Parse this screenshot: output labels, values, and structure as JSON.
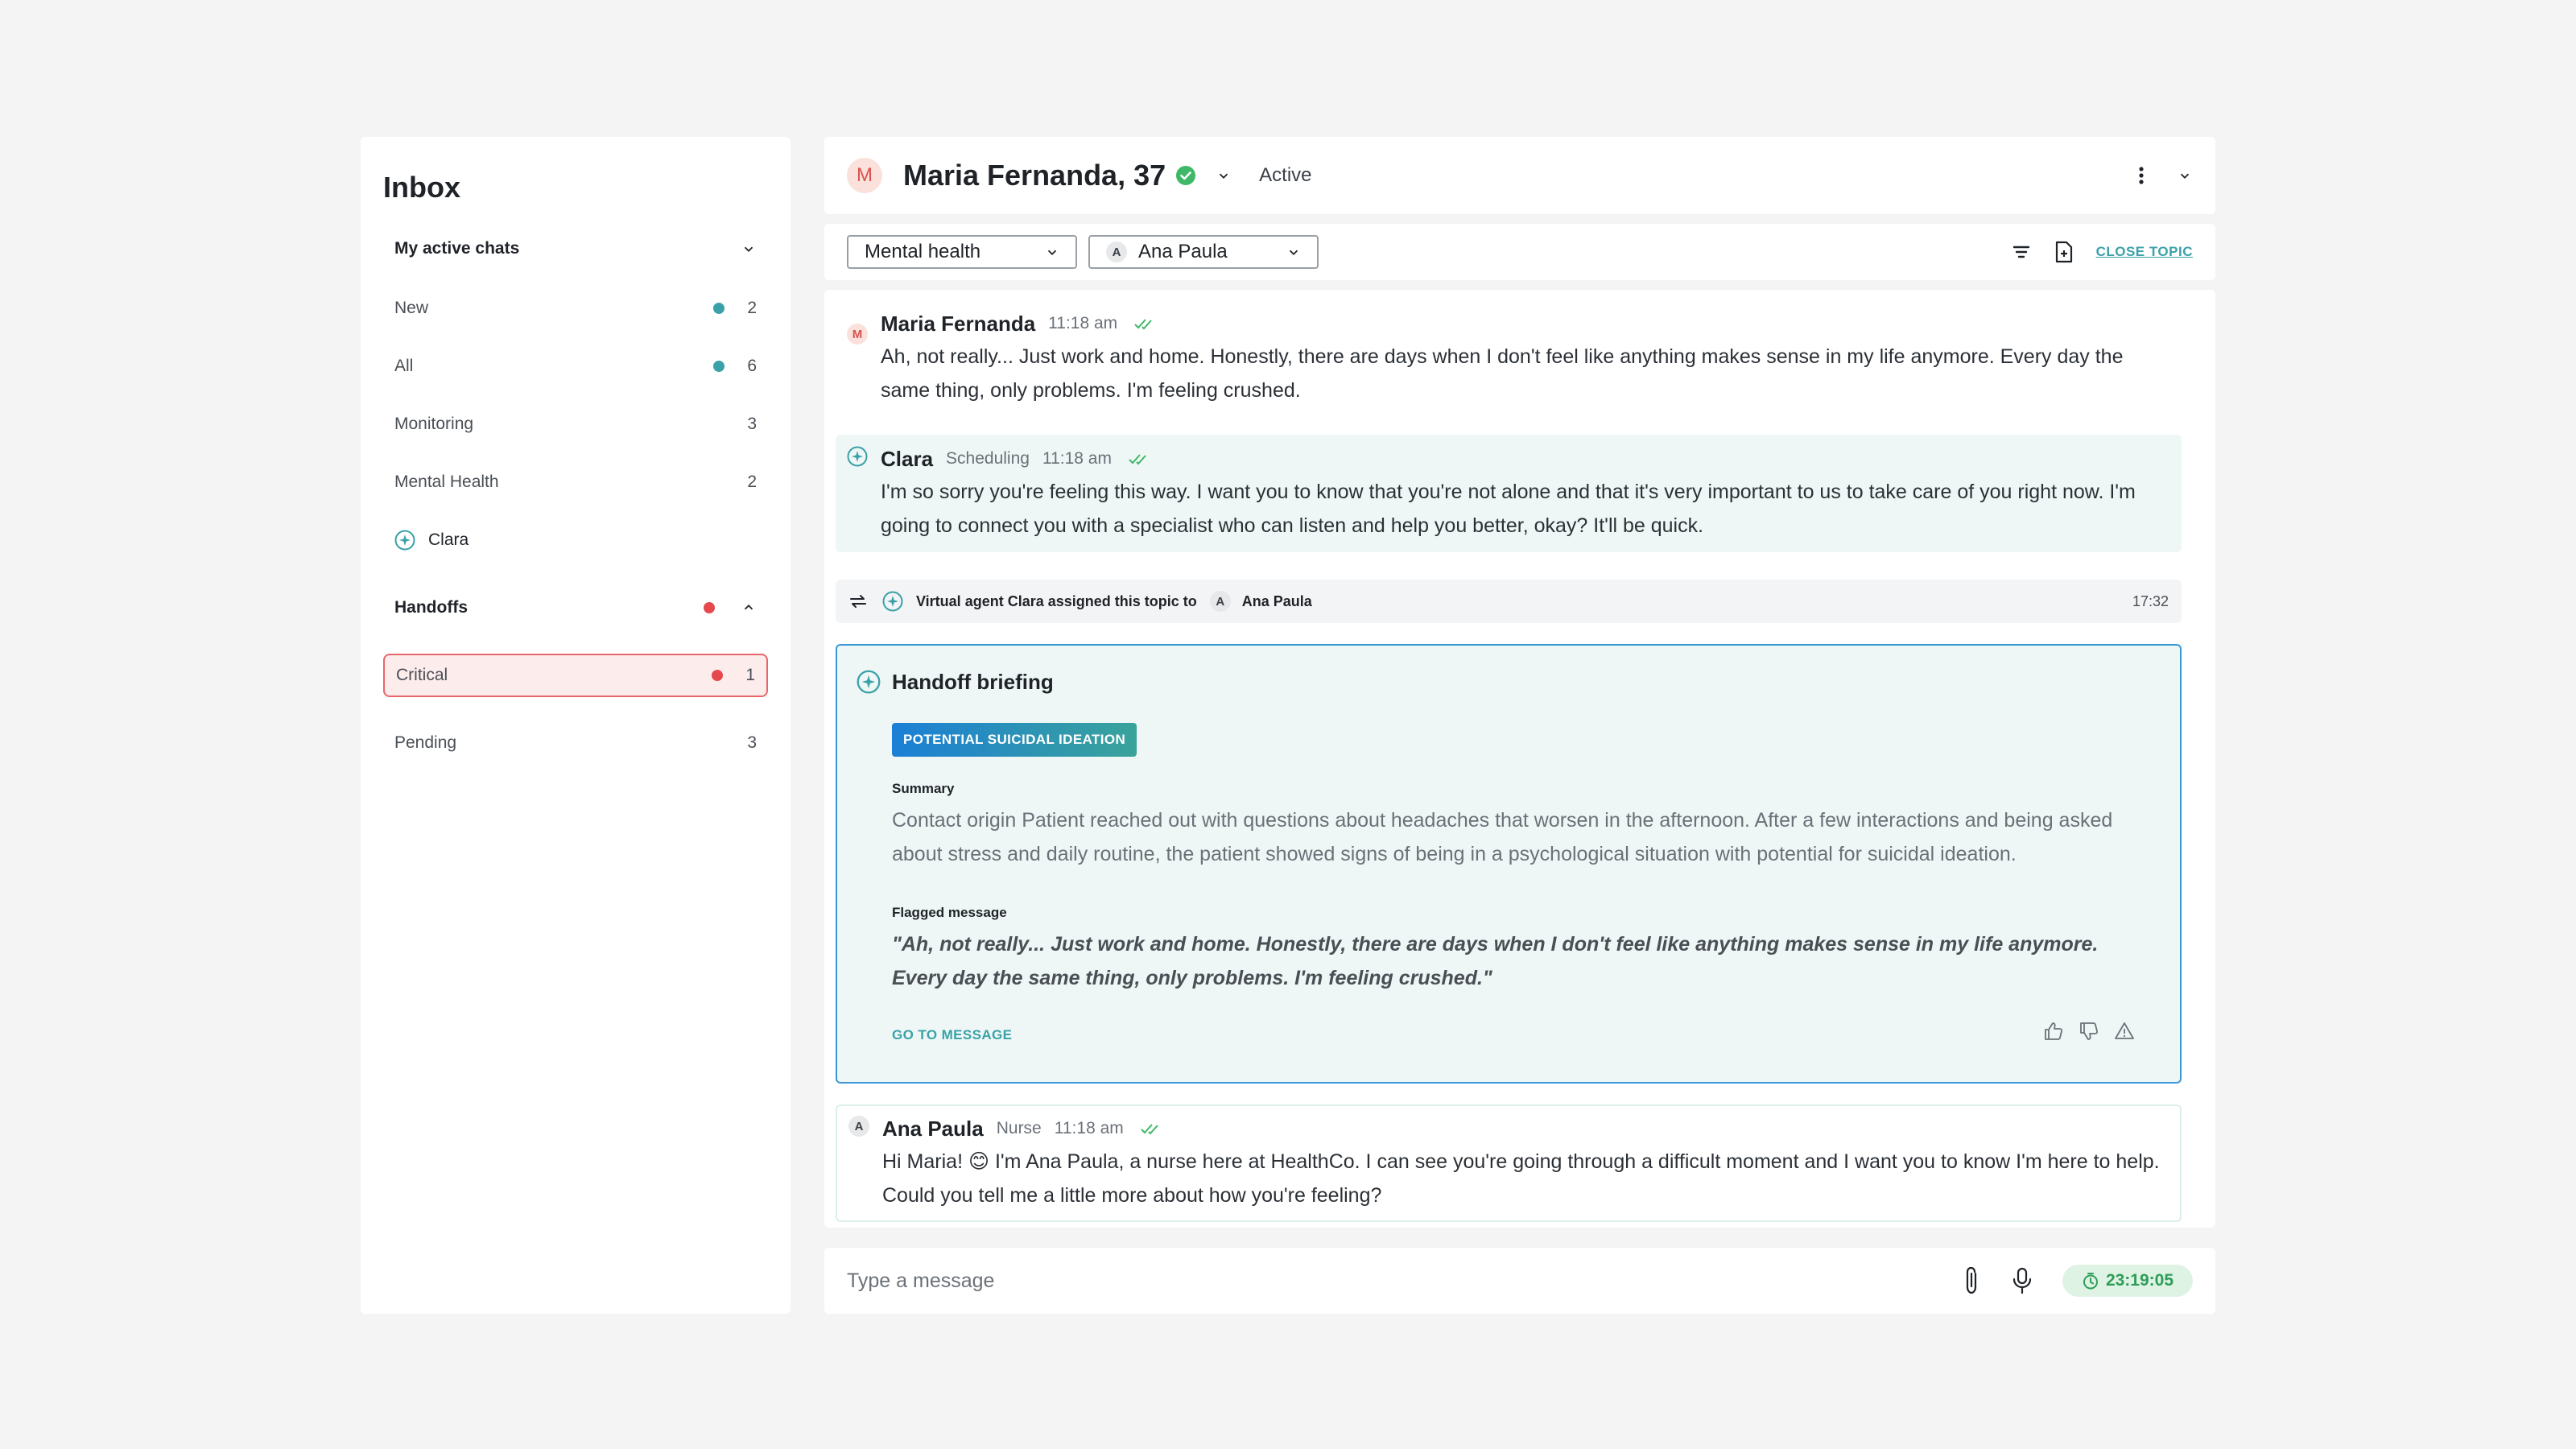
{
  "sidebar": {
    "title": "Inbox",
    "my_active_chats": {
      "label": "My active chats",
      "items": [
        {
          "label": "New",
          "count": "2",
          "dot": "#3aa1a9"
        },
        {
          "label": "All",
          "count": "6",
          "dot": "#3aa1a9"
        },
        {
          "label": "Monitoring",
          "count": "3"
        },
        {
          "label": "Mental Health",
          "count": "2"
        },
        {
          "label": "Clara"
        }
      ]
    },
    "handoffs": {
      "label": "Handoffs",
      "dot": "#e5484d",
      "items": [
        {
          "label": "Critical",
          "count": "1",
          "dot": "#e5484d"
        },
        {
          "label": "Pending",
          "count": "3"
        }
      ]
    }
  },
  "header": {
    "avatar_initial": "M",
    "patient_name": "Maria Fernanda, 37",
    "status": "Active"
  },
  "toolbar": {
    "topic_select": "Mental health",
    "agent_initial": "A",
    "agent_select": "Ana Paula",
    "close_topic": "CLOSE TOPIC"
  },
  "messages": [
    {
      "initial": "M",
      "author": "Maria Fernanda",
      "time": "11:18 am",
      "text": "Ah, not really... Just work and home. Honestly, there are days when I don't feel like anything makes sense in my life anymore. Every day the same thing, only problems. I'm feeling crushed."
    },
    {
      "author": "Clara",
      "role": "Scheduling",
      "time": "11:18 am",
      "text": "I'm so sorry you're feeling this way. I want you to know that you're not alone and that it's very important to us to take care of you right now. I'm going to connect you with a specialist who can listen and help you better, okay? It'll be quick."
    },
    {
      "initial": "A",
      "author": "Ana Paula",
      "role": "Nurse",
      "time": "11:18 am",
      "text": "Hi Maria! 😊 I'm Ana Paula, a nurse here at HealthCo. I can see you're going through a difficult moment and I want you to know I'm here to help. Could you tell me a little more about how you're feeling?"
    }
  ],
  "system_event": {
    "text": "Virtual agent Clara assigned this topic to",
    "agent_initial": "A",
    "agent": "Ana Paula",
    "time": "17:32"
  },
  "briefing": {
    "title": "Handoff briefing",
    "tag": "POTENTIAL SUICIDAL IDEATION",
    "summary_label": "Summary",
    "summary": "Contact origin Patient reached out with questions about headaches that worsen in the afternoon. After a few interactions and being asked about stress and daily routine, the patient showed signs of being in a psychological situation with potential for suicidal ideation.",
    "flagged_label": "Flagged message",
    "flagged": "\"Ah, not really... Just work and home. Honestly, there are days when I don't feel like anything makes sense in my life anymore. Every day the same thing, only problems. I'm feeling crushed.\"",
    "goto": "GO TO MESSAGE"
  },
  "composer": {
    "placeholder": "Type a message",
    "timer": "23:19:05"
  },
  "colors": {
    "accent": "#3aa1a9",
    "critical": "#e5484d",
    "success": "#2f9d58",
    "briefing_border": "#3a98d8"
  }
}
